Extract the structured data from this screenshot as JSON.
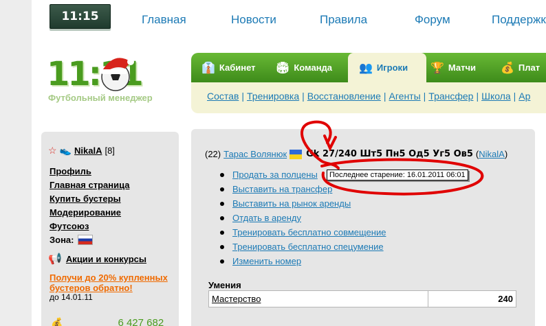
{
  "clock": "11:15",
  "topnav": [
    "Главная",
    "Новости",
    "Правила",
    "Форум",
    "Поддержка"
  ],
  "logo": {
    "number": "11:11",
    "subtitle": "Футбольный менеджер"
  },
  "tabs": [
    {
      "label": "Кабинет",
      "icon": "manager-icon"
    },
    {
      "label": "Команда",
      "icon": "stadium-icon"
    },
    {
      "label": "Игроки",
      "icon": "players-icon"
    },
    {
      "label": "Матчи",
      "icon": "trophy-icon"
    },
    {
      "label": "Плат",
      "icon": "coins-icon"
    }
  ],
  "sublinks": [
    "Состав",
    "Тренировка",
    "Восстановление",
    "Агенты",
    "Трансфер",
    "Школа",
    "Ар"
  ],
  "user": {
    "name": "NikalA",
    "level": "[8]"
  },
  "side_menu": [
    "Профиль",
    "Главная страница",
    "Купить бустеры",
    "Модерирование",
    "Футсоюз"
  ],
  "zone_label": "Зона:",
  "promo": "Акции и конкурсы",
  "bonus": "Получи до 20% купленных бустеров обратно!",
  "bonus_date": "до 14.01.11",
  "money": "6 427 682",
  "player": {
    "age": "(22)",
    "name": "Тарас Волянюк",
    "stats": "Gk 27/240 Шт5 Пн5 Од5 Уг5 Ов5",
    "owner": "NikalA"
  },
  "actions": [
    "Продать за полцены",
    "Выставить на трансфер",
    "Выставить на рынок аренды",
    "Отдать в аренду",
    "Тренировать бесплатно совмещение",
    "Тренировать бесплатно спецумение",
    "Изменить номер"
  ],
  "tooltip": "Последнее старение: 16.01.2011 06:01",
  "skills": {
    "title": "Умения",
    "rows": [
      {
        "name": "Мастерство",
        "value": "240"
      }
    ]
  },
  "colors": {
    "link": "#1c7ab5",
    "green": "#4a9c1f",
    "annotation": "#e00000",
    "orange": "#f06a00"
  }
}
